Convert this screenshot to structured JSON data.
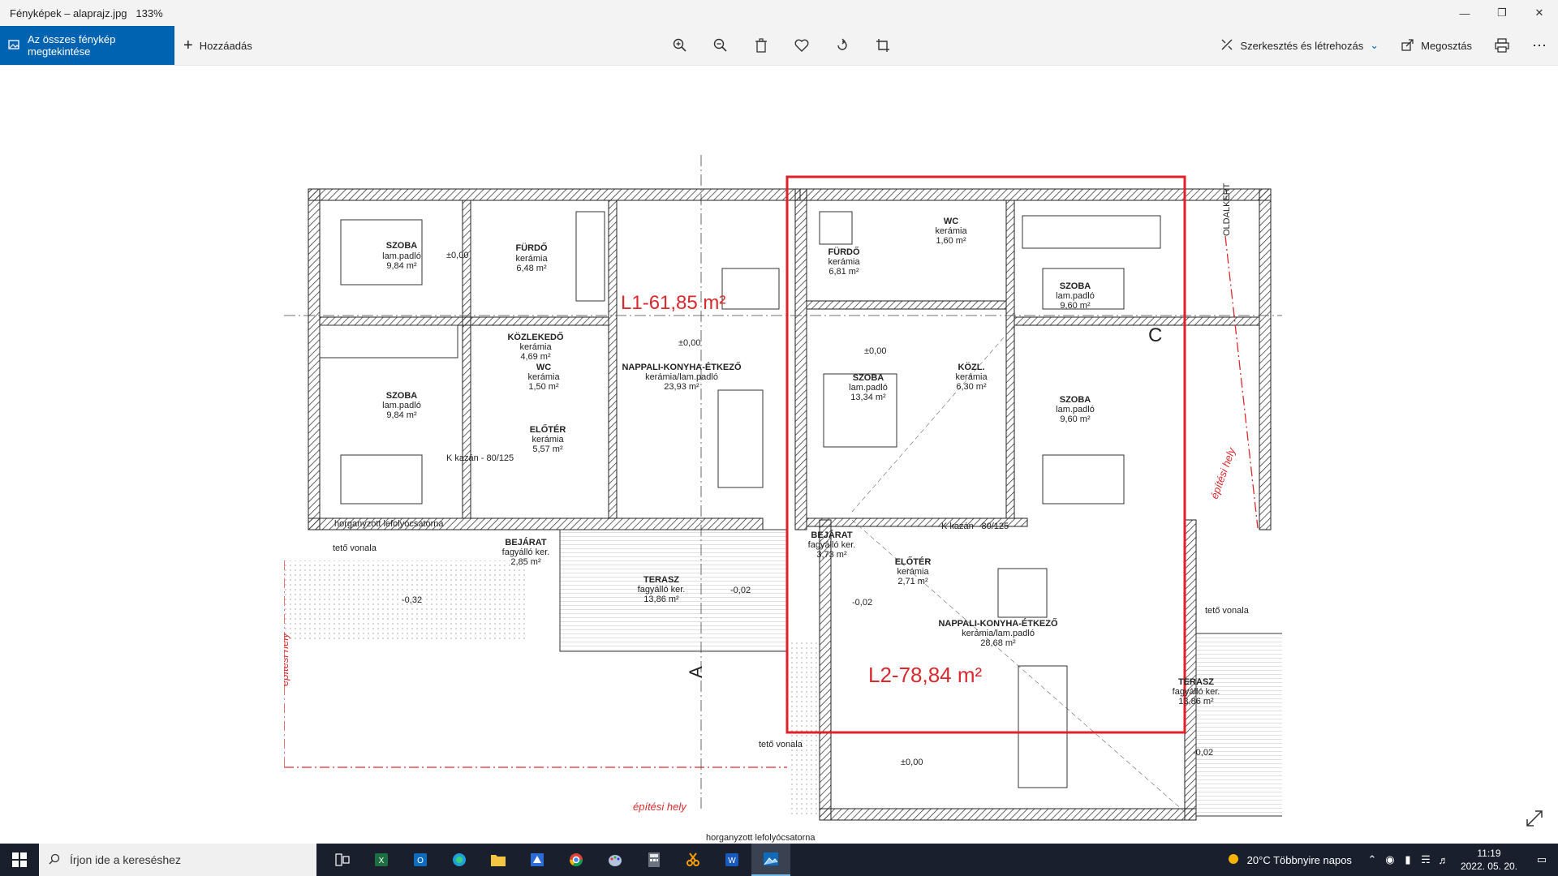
{
  "window": {
    "title": "Fényképek – alaprajz.jpg",
    "zoom": "133%"
  },
  "toolbar": {
    "all_photos_label": "Az összes fénykép megtekintése",
    "add_label": "Hozzáadás",
    "edit_label": "Szerkesztés és létrehozás",
    "share_label": "Megosztás"
  },
  "plan": {
    "l1_area": "L1-61,85 m²",
    "l2_area": "L2-78,84 m²",
    "section_a": "A",
    "section_c": "C",
    "rooms_left": [
      {
        "name": "SZOBA",
        "floor": "lam.padló",
        "area": "9,84 m²"
      },
      {
        "name": "FÜRDŐ",
        "floor": "kerámia",
        "area": "6,48 m²"
      },
      {
        "name": "KÖZLEKEDŐ",
        "floor": "kerámia",
        "area": "4,69 m²"
      },
      {
        "name": "WC",
        "floor": "kerámia",
        "area": "1,50 m²"
      },
      {
        "name": "NAPPALI-KONYHA-ÉTKEZŐ",
        "floor": "kerámia/lam.padló",
        "area": "23,93 m²"
      },
      {
        "name": "SZOBA",
        "floor": "lam.padló",
        "area": "9,84 m²"
      },
      {
        "name": "ELŐTÉR",
        "floor": "kerámia",
        "area": "5,57 m²"
      },
      {
        "name": "BEJÁRAT",
        "floor": "fagyálló ker.",
        "area": "2,85 m²"
      },
      {
        "name": "TERASZ",
        "floor": "fagyálló ker.",
        "area": "13,86 m²"
      }
    ],
    "rooms_right": [
      {
        "name": "FÜRDŐ",
        "floor": "kerámia",
        "area": "6,81 m²"
      },
      {
        "name": "WC",
        "floor": "kerámia",
        "area": "1,60 m²"
      },
      {
        "name": "SZOBA",
        "floor": "lam.padló",
        "area": "9,60 m²"
      },
      {
        "name": "SZOBA",
        "floor": "lam.padló",
        "area": "13,34 m²"
      },
      {
        "name": "KÖZL.",
        "floor": "kerámia",
        "area": "6,30 m²"
      },
      {
        "name": "SZOBA",
        "floor": "lam.padló",
        "area": "9,60 m²"
      },
      {
        "name": "BEJÁRAT",
        "floor": "fagyálló ker.",
        "area": "3,73 m²"
      },
      {
        "name": "ELŐTÉR",
        "floor": "kerámia",
        "area": "2,71 m²"
      },
      {
        "name": "NAPPALI-KONYHA-ÉTKEZŐ",
        "floor": "kerámia/lam.padló",
        "area": "28,68 m²"
      },
      {
        "name": "TERASZ",
        "floor": "fagyálló ker.",
        "area": "13,86 m²"
      }
    ],
    "notes": {
      "gutter": "horganyzott lefolyócsatorna",
      "roof_line": "tető vonala",
      "build_site": "építési hely",
      "boiler": "K kazán - 80/125",
      "side_border": "OLDALKERT",
      "level_0": "±0,00",
      "level_m002": "-0,02",
      "level_m032": "-0,32"
    }
  },
  "taskbar": {
    "search_placeholder": "Írjon ide a kereséshez",
    "weather": "20°C  Többnyire napos",
    "time": "11:19",
    "date": "2022. 05. 20."
  }
}
